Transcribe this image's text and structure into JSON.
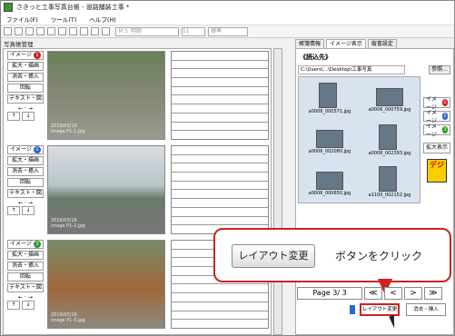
{
  "window": {
    "title": "さきっと工事写真台帳 - 道路舗装工事 *"
  },
  "menu": [
    "ファイル(F)",
    "ツール(T)",
    "ヘルプ(H)"
  ],
  "toolbar": {
    "font": "ＭＳ 明朝",
    "size": "11",
    "style": "標準"
  },
  "left": {
    "title": "写真帳管理",
    "blocks": [
      {
        "label": "イメージ",
        "badge": "1",
        "badge_color": "#cc2222",
        "date": "2019/05/16",
        "file": "image P1-1.jpg"
      },
      {
        "label": "イメージ",
        "badge": "2",
        "badge_color": "#2a66cc",
        "date": "2019/05/16",
        "file": "image P1-2.jpg"
      },
      {
        "label": "イメージ",
        "badge": "3",
        "badge_color": "#2a9a2a",
        "date": "2019/05/16",
        "file": "image P1-3.jpg"
      }
    ],
    "buttons": {
      "enlarge": "拡大・描画",
      "clear": "消去・挿入",
      "rotate": "回転",
      "text": "テキスト・図"
    }
  },
  "right": {
    "tabs": [
      "帳簿情報",
      "イメージ表示",
      "縦書設定"
    ],
    "folder_head": "《読込先》",
    "path": "C:\\Users\\...\\Desktop\\工事写真",
    "browse": "参照...",
    "thumbs": [
      "a0006_000571.jpg",
      "a0006_000759.jpg",
      "a0006_002080.jpg",
      "a0006_002393.jpg",
      "a0006_000650.jpg",
      "a1100_002152.jpg"
    ],
    "side": [
      "イメージ",
      "イメージ",
      "イメージ"
    ],
    "zoom": "拡大表示",
    "degi": "デジ"
  },
  "nav": {
    "page": "Page 3/ 3",
    "first": "≪",
    "prev": "<",
    "next": ">",
    "last": "≫"
  },
  "bottom": {
    "layout": "レイアウト変更",
    "clear": "消去・挿入"
  },
  "callout": {
    "button": "レイアウト変更",
    "text": "ボタンをクリック"
  }
}
